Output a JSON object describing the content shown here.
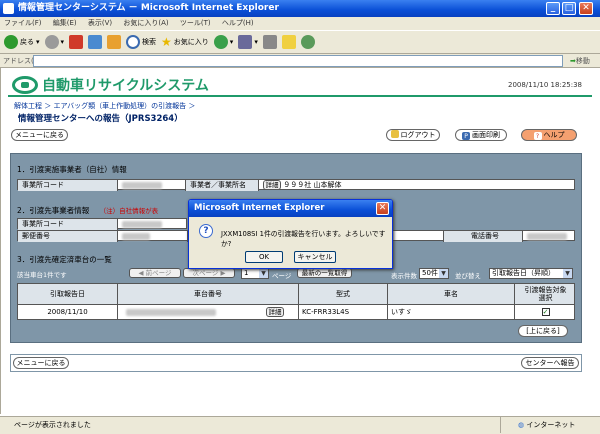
{
  "window": {
    "title": "情報管理センターシステム － Microsoft Internet Explorer"
  },
  "menu": [
    "ファイル(F)",
    "編集(E)",
    "表示(V)",
    "お気に入り(A)",
    "ツール(T)",
    "ヘルプ(H)"
  ],
  "toolbar": {
    "back": "戻る",
    "search": "検索",
    "favorites": "お気に入り"
  },
  "address": {
    "label": "アドレス(D)",
    "go": "移動",
    "links": "リンク"
  },
  "header": {
    "logo": "自動車リサイクルシステム",
    "datetime": "2008/11/10  18:25:38",
    "breadcrumb": "解体工程  ＞  エアバッグ類（車上作動処理）の引渡報告  ＞",
    "page_title": "情報管理センターへの報告（JPRS3264）"
  },
  "buttons": {
    "menu_back": "メニューに戻る",
    "logout": "ログアウト",
    "print": "画面印刷",
    "help": "ヘルプ",
    "back_to_top": "[上に戻る]",
    "report_to_center": "センターへ報告"
  },
  "section1": {
    "title": "1．引渡実施事業者（自社）情報",
    "office_code_label": "事業所コード",
    "biz_name_label": "事業者／事業所名",
    "detail": "詳細",
    "biz_name_value": "９９９社  山本解体"
  },
  "section2": {
    "title": "2．引渡先事業者情報",
    "note": "（注）自社情報が表",
    "office_code_label": "事業所コード",
    "postal_label": "郵便番号",
    "phone_label": "電話番号"
  },
  "section3": {
    "title": "3．引渡先確定済車台の一覧",
    "selected_label": "該当車台1件です",
    "prev_page": "前ページ",
    "next_page": "次ページ",
    "page_num": "1",
    "page_unit": "ページ",
    "refresh": "最新の一覧取得",
    "display_count_label": "表示件数",
    "display_count": "50件",
    "sort_label": "並び替え",
    "sort_value": "引取報告日（昇順）",
    "columns": [
      "引取報告日",
      "車台番号",
      "型式",
      "車名",
      "引渡報告対象選択"
    ],
    "rows": [
      {
        "date": "2008/11/10",
        "detail": "詳細",
        "model": "KC-FRR33L4S",
        "name": "いすゞ",
        "selected": "✓"
      }
    ]
  },
  "dialog": {
    "title": "Microsoft Internet Explorer",
    "message": "JXXM108SI 1件の引渡報告を行います。よろしいですか?",
    "ok": "OK",
    "cancel": "キャンセル"
  },
  "status": {
    "left": "ページが表示されました",
    "zone": "インターネット"
  }
}
